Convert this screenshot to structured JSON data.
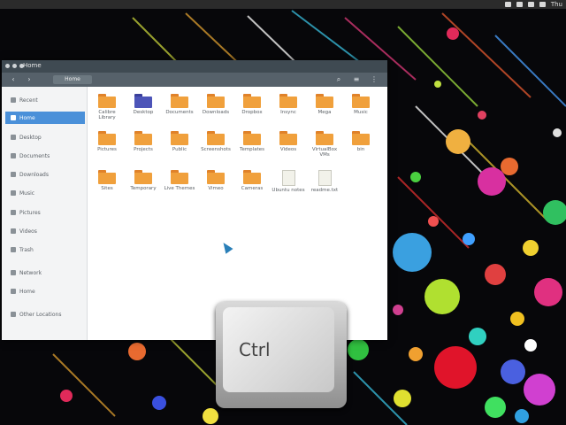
{
  "topbar": {
    "clock": "Thu"
  },
  "window": {
    "title": "Home",
    "path": "Home",
    "back": "‹",
    "forward": "›",
    "search_icon": "search-icon",
    "view_icon": "list-view-icon",
    "menu_icon": "menu-icon"
  },
  "sidebar": {
    "items": [
      {
        "label": "Recent",
        "icon": "clock-icon"
      },
      {
        "label": "Home",
        "icon": "home-icon",
        "active": true
      },
      {
        "label": "Desktop",
        "icon": "desktop-icon"
      },
      {
        "label": "Documents",
        "icon": "document-icon"
      },
      {
        "label": "Downloads",
        "icon": "download-icon"
      },
      {
        "label": "Music",
        "icon": "music-icon"
      },
      {
        "label": "Pictures",
        "icon": "picture-icon"
      },
      {
        "label": "Videos",
        "icon": "video-icon"
      },
      {
        "label": "Trash",
        "icon": "trash-icon"
      },
      {
        "label": "Network",
        "icon": "network-icon"
      },
      {
        "label": "Home",
        "icon": "drive-icon"
      },
      {
        "label": "Other Locations",
        "icon": "plus-icon"
      }
    ]
  },
  "files": [
    {
      "label": "Calibre Library",
      "type": "folder"
    },
    {
      "label": "Desktop",
      "type": "folder-blue"
    },
    {
      "label": "Documents",
      "type": "folder"
    },
    {
      "label": "Downloads",
      "type": "folder"
    },
    {
      "label": "Dropbox",
      "type": "folder"
    },
    {
      "label": "Insync",
      "type": "folder"
    },
    {
      "label": "Mega",
      "type": "folder"
    },
    {
      "label": "Music",
      "type": "folder"
    },
    {
      "label": "Pictures",
      "type": "folder"
    },
    {
      "label": "Projects",
      "type": "folder"
    },
    {
      "label": "Public",
      "type": "folder"
    },
    {
      "label": "Screenshots",
      "type": "folder"
    },
    {
      "label": "Templates",
      "type": "folder"
    },
    {
      "label": "Videos",
      "type": "folder"
    },
    {
      "label": "VirtualBox VMs",
      "type": "folder"
    },
    {
      "label": "bin",
      "type": "folder"
    },
    {
      "label": "Sites",
      "type": "folder"
    },
    {
      "label": "Temporary",
      "type": "folder"
    },
    {
      "label": "Live Themes",
      "type": "folder"
    },
    {
      "label": "Vimeo",
      "type": "folder"
    },
    {
      "label": "Cameras",
      "type": "folder"
    },
    {
      "label": "Ubuntu notes",
      "type": "doc"
    },
    {
      "label": "readme.txt",
      "type": "doc"
    }
  ],
  "key": {
    "label": "Ctrl"
  }
}
